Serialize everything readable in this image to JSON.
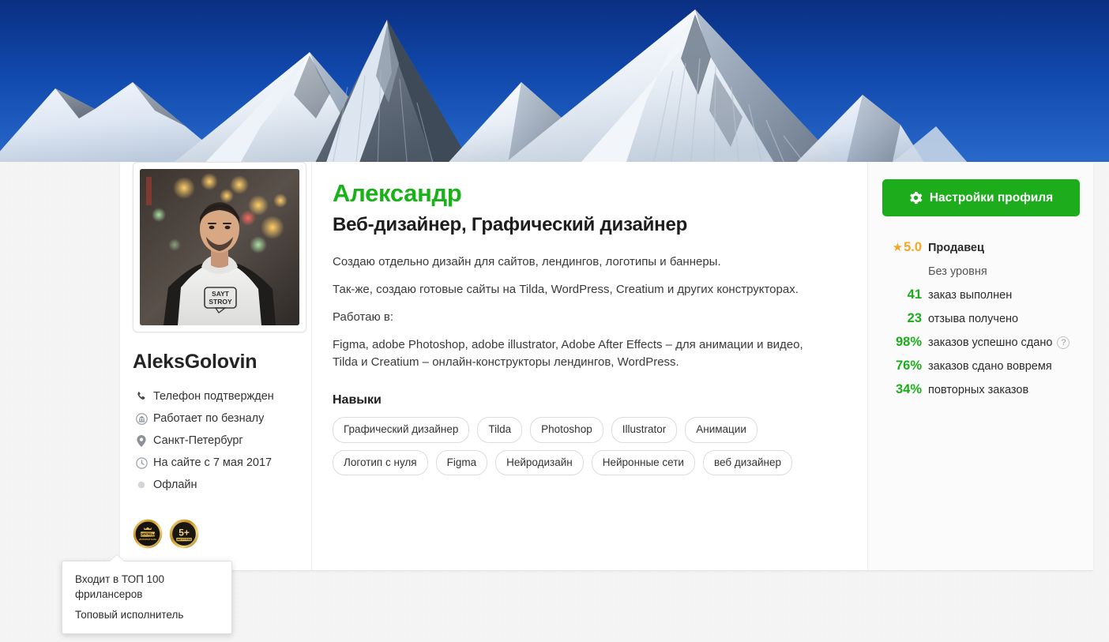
{
  "cover": {
    "alt": "snow-capped-mountain-peaks-against-deep-blue-sky"
  },
  "profile": {
    "username": "AleksGolovin",
    "display_name": "Александр",
    "headline": "Веб-дизайнер, Графический дизайнер",
    "avatar_alt": "portrait-of-man-in-white-hoodie-with-SAYT-STROY-logo",
    "avatar_shirt_text_line1": "SAYT",
    "avatar_shirt_text_line2": "STROY"
  },
  "info": [
    {
      "icon": "phone-icon",
      "label": "Телефон подтвержден"
    },
    {
      "icon": "bank-icon",
      "label": "Работает по безналу"
    },
    {
      "icon": "location-pin-icon",
      "label": "Санкт-Петербург"
    },
    {
      "icon": "clock-icon",
      "label": "На сайте с 7 мая 2017"
    },
    {
      "icon": "offline-dot-icon",
      "label": "Офлайн"
    }
  ],
  "badges": [
    {
      "name": "top-performer-medal",
      "caption": "ТОПОВЫЙ"
    },
    {
      "name": "five-plus-years-medal",
      "caption": "5+"
    }
  ],
  "tooltip": {
    "line1": "Входит в ТОП 100 фрилансеров",
    "line2": "Топовый исполнитель"
  },
  "about": {
    "paragraph1": "Создаю отдельно дизайн для сайтов, лендингов, логотипы и баннеры.",
    "paragraph2": "Так-же, создаю готовые сайты на Tilda, WordPress, Creatium и других конструкторах.",
    "paragraph3": "Работаю в:",
    "paragraph4_line1": "Figma, adobe Photoshop, adobe illustrator, Adobe After Effects – для анимации и видео,",
    "paragraph4_line2": "Tilda и Creatium – онлайн-конструкторы лендингов, WordPress."
  },
  "skills": {
    "title": "Навыки",
    "tags": [
      "Графический дизайнер",
      "Tilda",
      "Photoshop",
      "Illustrator",
      "Анимации",
      "Логотип с нуля",
      "Figma",
      "Нейродизайн",
      "Нейронные сети",
      "веб дизайнер"
    ]
  },
  "sidebar": {
    "settings_button": "Настройки профиля",
    "settings_icon": "gear-icon",
    "stats": [
      {
        "value": "5.0",
        "label": "Продавец",
        "style": "rating"
      },
      {
        "value": "",
        "label": "Без уровня",
        "style": "muted"
      },
      {
        "value": "41",
        "label": "заказ выполнен",
        "style": "green"
      },
      {
        "value": "23",
        "label": "отзыва получено",
        "style": "green"
      },
      {
        "value": "98%",
        "label": "заказов успешно сдано",
        "style": "green",
        "help": "?"
      },
      {
        "value": "76%",
        "label": "заказов сдано вовремя",
        "style": "green"
      },
      {
        "value": "34%",
        "label": "повторных заказов",
        "style": "green"
      }
    ]
  },
  "colors": {
    "brand_green": "#1cac1c",
    "name_green": "#19b319",
    "amber": "#f5a623",
    "page_bg": "#f4f4f4",
    "card_bg": "#ffffff",
    "sidebar_bg": "#fbfbfb",
    "sky_blue": "#0f3f9e"
  }
}
